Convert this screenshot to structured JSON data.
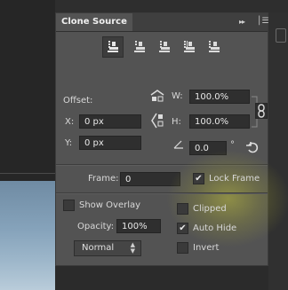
{
  "panel": {
    "title": "Clone Source",
    "collapse_glyph": "▸▸",
    "menu_glyph": "│☰"
  },
  "sources": [
    {
      "icon": "clone-source-stamp-icon",
      "active": true
    },
    {
      "icon": "clone-source-stamp-icon",
      "active": false
    },
    {
      "icon": "clone-source-stamp-icon",
      "active": false
    },
    {
      "icon": "clone-source-stamp-icon",
      "active": false
    },
    {
      "icon": "clone-source-stamp-icon",
      "active": false
    }
  ],
  "offset": {
    "label": "Offset:",
    "x_label": "X:",
    "x_value": "0 px",
    "y_label": "Y:",
    "y_value": "0 px",
    "w_label": "W:",
    "w_value": "100.0%",
    "h_label": "H:",
    "h_value": "100.0%",
    "angle_value": "0.0",
    "degree": "°"
  },
  "frame": {
    "label": "Frame:",
    "value": "0",
    "lock_label": "Lock Frame",
    "lock_checked": true
  },
  "overlay": {
    "show_label": "Show Overlay",
    "show_checked": false,
    "opacity_label": "Opacity:",
    "opacity_value": "100%",
    "mode_value": "Normal",
    "clipped_label": "Clipped",
    "clipped_checked": false,
    "autohide_label": "Auto Hide",
    "autohide_checked": true,
    "invert_label": "Invert",
    "invert_checked": false
  },
  "colors": {
    "panel_bg": "#535353",
    "field_bg": "#2f2f2f",
    "highlight": "#c8c850"
  }
}
